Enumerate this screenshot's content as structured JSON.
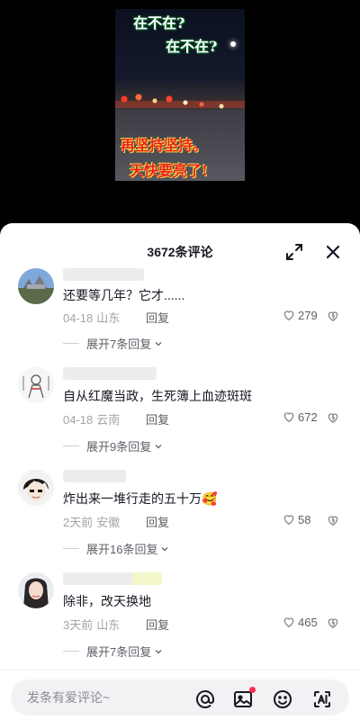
{
  "video": {
    "captions": [
      "在不在?",
      "在不在?",
      "再坚持坚持。",
      "天快要亮了!"
    ]
  },
  "sheet": {
    "title": "3672条评论",
    "expand_icon": "expand-icon",
    "close_icon": "close-icon"
  },
  "comments": [
    {
      "text": "还要等几年？它才......",
      "date": "04-18",
      "location": "山东",
      "reply_label": "回复",
      "likes": "279",
      "replies_label": "展开7条回复"
    },
    {
      "text": "自从红魔当政，生死簿上血迹斑斑",
      "date": "04-18",
      "location": "云南",
      "reply_label": "回复",
      "likes": "672",
      "replies_label": "展开9条回复"
    },
    {
      "text": "炸出来一堆行走的五十万🥰",
      "date": "2天前",
      "location": "安徽",
      "reply_label": "回复",
      "likes": "58",
      "replies_label": "展开16条回复"
    },
    {
      "text": "除非，改天换地",
      "date": "3天前",
      "location": "山东",
      "reply_label": "回复",
      "likes": "465",
      "replies_label": "展开7条回复"
    }
  ],
  "input": {
    "placeholder": "发条有爱评论~",
    "icons": [
      "at-icon",
      "image-icon",
      "emoji-icon",
      "ai-icon"
    ],
    "notification_color": "#fe2c55"
  }
}
